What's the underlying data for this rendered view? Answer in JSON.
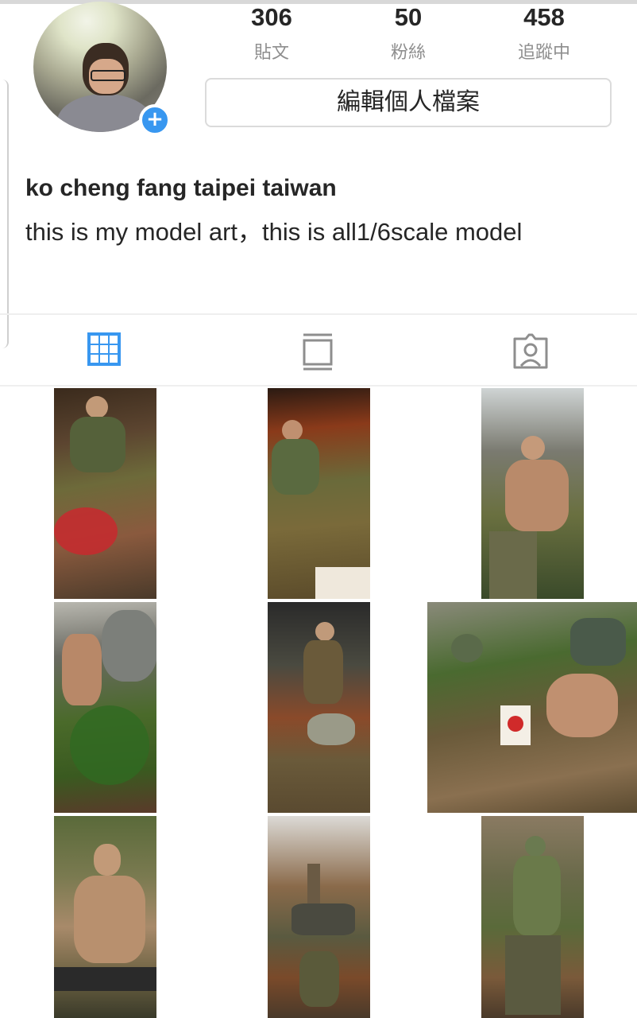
{
  "profile": {
    "stats": [
      {
        "value": "306",
        "label": "貼文"
      },
      {
        "value": "50",
        "label": "粉絲"
      },
      {
        "value": "458",
        "label": "追蹤中"
      }
    ],
    "edit_label": "編輯個人檔案",
    "add_glyph": "+",
    "name": "ko cheng fang taipei taiwan",
    "bio": "this is my model  art，this is all1/6scale model"
  },
  "tabs": [
    {
      "name": "grid-icon",
      "active": true
    },
    {
      "name": "feed-icon",
      "active": false
    },
    {
      "name": "tagged-icon",
      "active": false
    }
  ],
  "colors": {
    "accent": "#3897f0",
    "text": "#262626",
    "muted": "#8e8e8e"
  },
  "posts": [
    {
      "theme": "soldiers-jungle-fight"
    },
    {
      "theme": "soldiers-flag-attack"
    },
    {
      "theme": "soldiers-grapple"
    },
    {
      "theme": "tank-palm-soldiers"
    },
    {
      "theme": "officer-battlefield"
    },
    {
      "theme": "jeep-flag-soldiers"
    },
    {
      "theme": "machine-gunner"
    },
    {
      "theme": "artillery-crew"
    },
    {
      "theme": "soldier-rifle-jungle"
    }
  ]
}
